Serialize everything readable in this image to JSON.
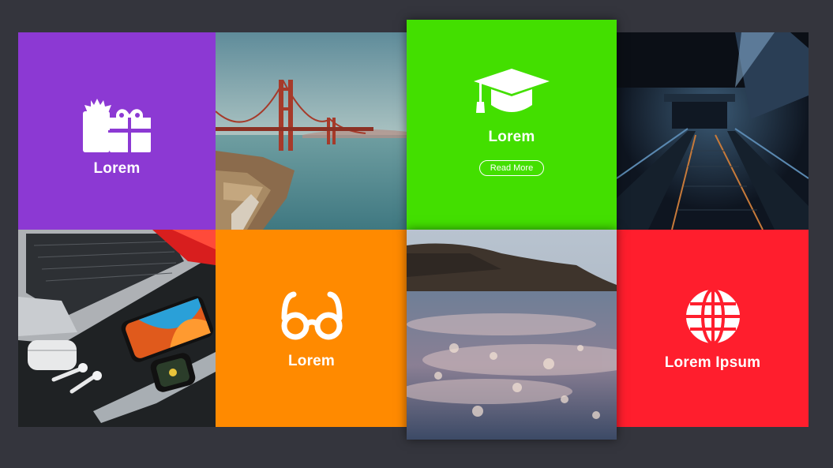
{
  "tiles": {
    "gift": {
      "label": "Lorem",
      "icon": "gift-icon",
      "color": "#8c39d3"
    },
    "graduation": {
      "label": "Lorem",
      "icon": "graduation-cap-icon",
      "color": "#43df00",
      "button_label": "Read More"
    },
    "glasses": {
      "label": "Lorem",
      "icon": "glasses-icon",
      "color": "#ff8a00"
    },
    "globe": {
      "label": "Lorem Ipsum",
      "icon": "globe-icon",
      "color": "#ff1e2d"
    }
  },
  "photos": {
    "bridge": "golden-gate-bridge-photo",
    "tunnel": "escalator-tunnel-photo",
    "tech": "laptop-phone-watch-photo",
    "water": "water-wave-shore-photo"
  },
  "colors": {
    "background": "#34353d"
  }
}
